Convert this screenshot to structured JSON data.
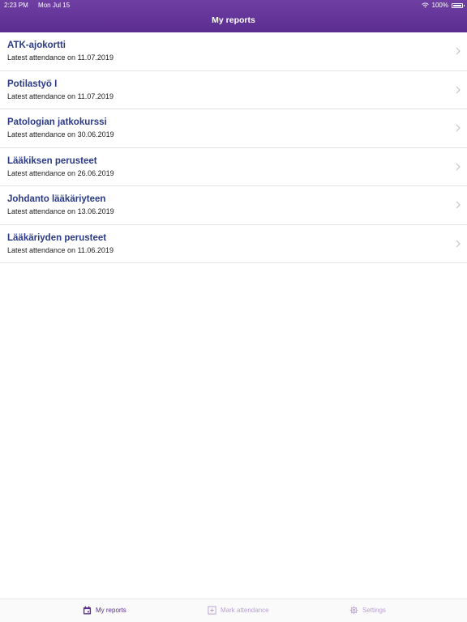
{
  "status_bar": {
    "time": "2:23 PM",
    "date": "Mon Jul 15",
    "battery": "100%"
  },
  "header": {
    "title": "My reports"
  },
  "reports": [
    {
      "title": "ATK-ajokortti",
      "subtitle": "Latest attendance on 11.07.2019"
    },
    {
      "title": "Potilastyö I",
      "subtitle": "Latest attendance on 11.07.2019"
    },
    {
      "title": "Patologian jatkokurssi",
      "subtitle": "Latest attendance on 30.06.2019"
    },
    {
      "title": "Lääkiksen perusteet",
      "subtitle": "Latest attendance on 26.06.2019"
    },
    {
      "title": "Johdanto lääkäriyteen",
      "subtitle": "Latest attendance on 13.06.2019"
    },
    {
      "title": "Lääkäriyden perusteet",
      "subtitle": "Latest attendance on 11.06.2019"
    }
  ],
  "tabbar": {
    "tabs": [
      {
        "label": "My reports",
        "icon": "calendar-icon",
        "active": true
      },
      {
        "label": "Mark attendance",
        "icon": "plus-square-icon",
        "active": false
      },
      {
        "label": "Settings",
        "icon": "gear-icon",
        "active": false
      }
    ]
  },
  "colors": {
    "header": "#5c2d91",
    "title_text": "#2a3a86",
    "tab_active": "#5c2d91",
    "tab_inactive": "#b99dd3"
  }
}
